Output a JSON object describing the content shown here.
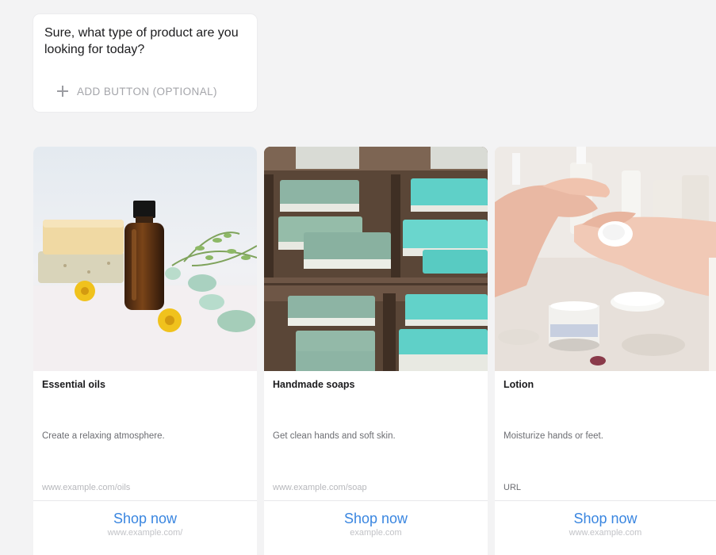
{
  "message": {
    "text": "Sure, what type of product are you looking for today?",
    "add_button_label": "ADD BUTTON (OPTIONAL)"
  },
  "cards": [
    {
      "title": "Essential oils",
      "description": "Create a relaxing atmosphere.",
      "url": "www.example.com/oils",
      "action_label": "Shop now",
      "action_url": "www.example.com/"
    },
    {
      "title": "Handmade soaps",
      "description": "Get clean hands and soft skin.",
      "url": "www.example.com/soap",
      "action_label": "Shop now",
      "action_url": "example.com"
    },
    {
      "title": "Lotion",
      "description": "Moisturize hands or feet.",
      "url": "URL",
      "action_label": "Shop now",
      "action_url": "www.example.com"
    }
  ],
  "colors": {
    "background": "#f3f3f4",
    "accent": "#3a86e0",
    "soap_teal": "#5fd0c8",
    "soap_sage": "#8fb5a5"
  }
}
